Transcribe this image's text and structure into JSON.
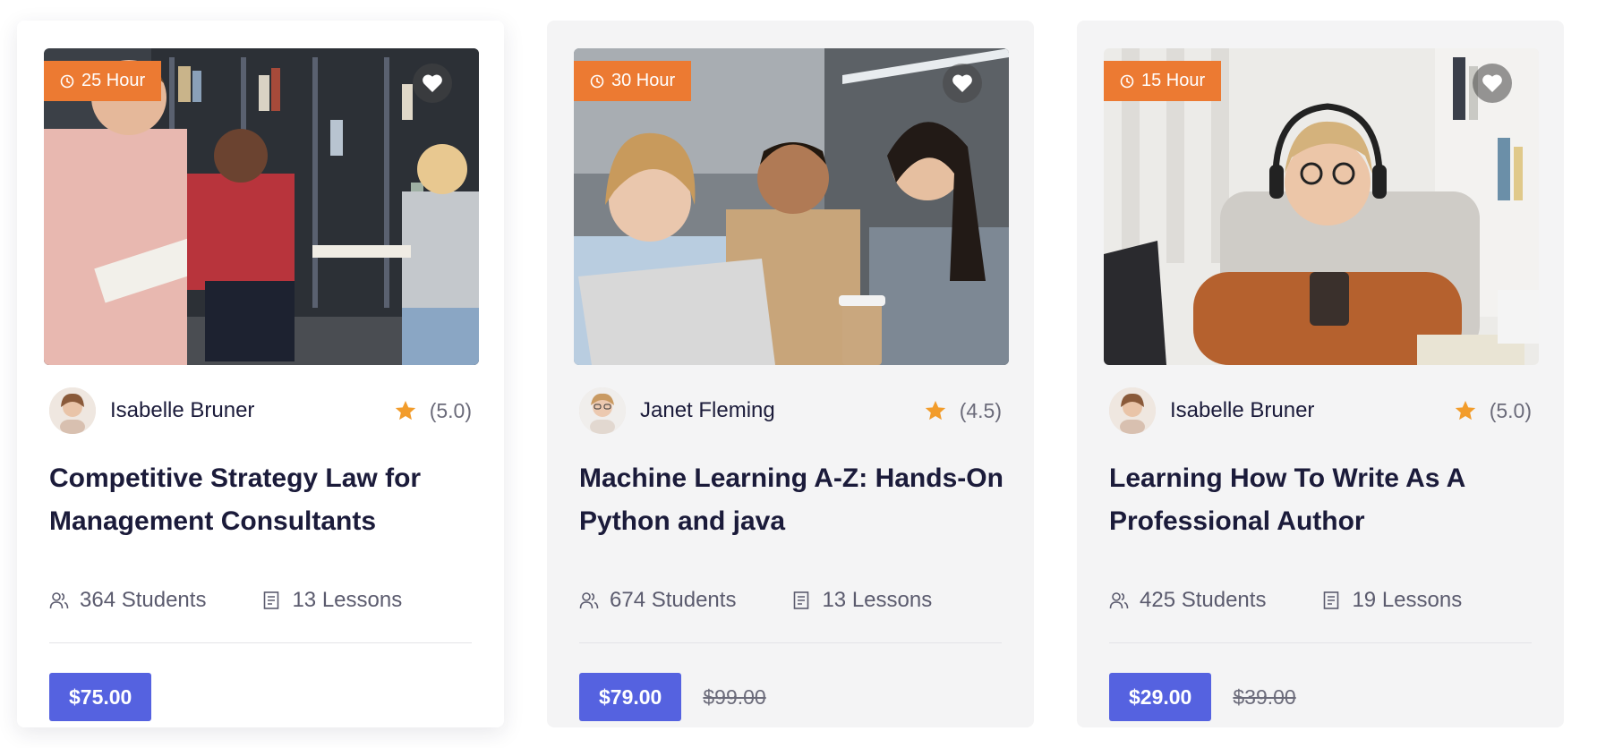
{
  "accent": "#5562e0",
  "badge_color": "#ec7a32",
  "star_color": "#f29c2b",
  "courses": [
    {
      "duration": "25 Hour",
      "author": "Isabelle Bruner",
      "rating": "(5.0)",
      "title": "Competitive Strategy Law for Management Consultants",
      "students": "364 Students",
      "lessons": "13 Lessons",
      "price": "$75.00",
      "old_price": ""
    },
    {
      "duration": "30 Hour",
      "author": "Janet Fleming",
      "rating": "(4.5)",
      "title": "Machine Learning A-Z: Hands-On Python and java",
      "students": "674 Students",
      "lessons": "13 Lessons",
      "price": "$79.00",
      "old_price": "$99.00"
    },
    {
      "duration": "15 Hour",
      "author": "Isabelle Bruner",
      "rating": "(5.0)",
      "title": "Learning How To Write As A Professional Author",
      "students": "425 Students",
      "lessons": "19 Lessons",
      "price": "$29.00",
      "old_price": "$39.00"
    }
  ]
}
